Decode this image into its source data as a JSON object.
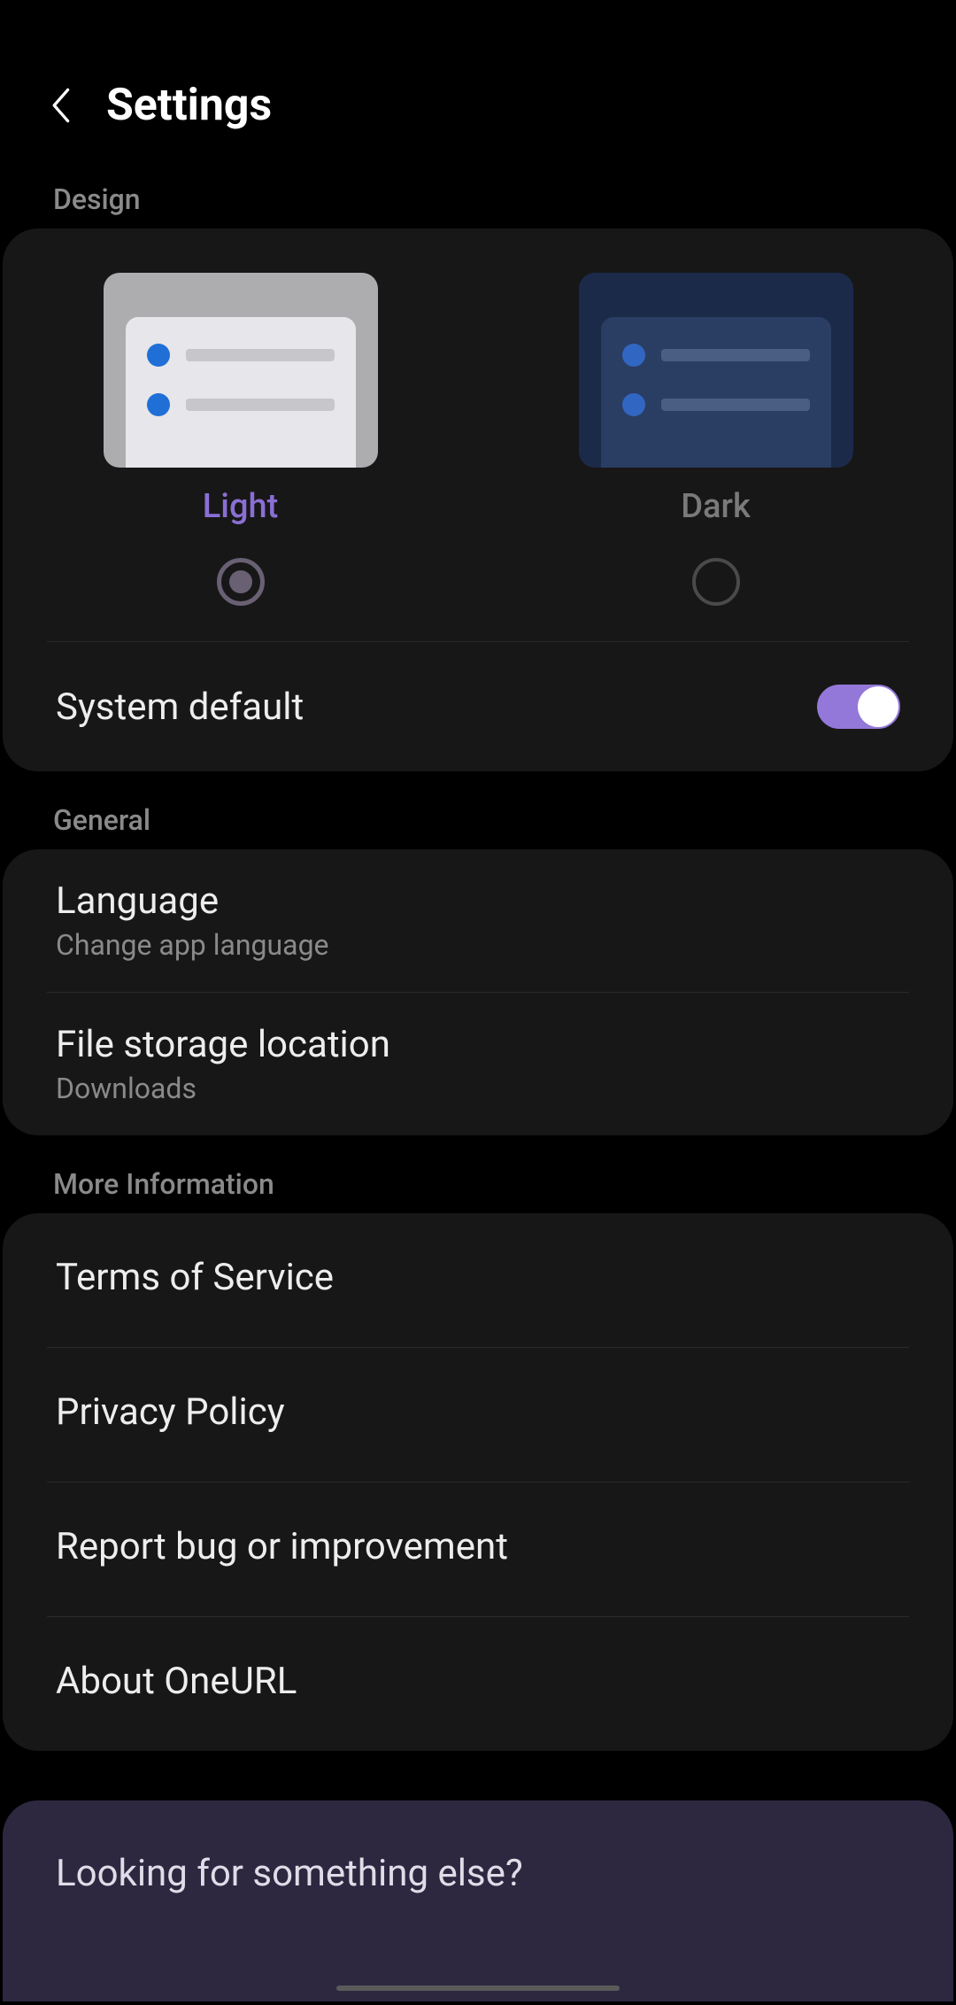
{
  "header": {
    "title": "Settings"
  },
  "design": {
    "section_label": "Design",
    "light_label": "Light",
    "dark_label": "Dark",
    "system_default_label": "System default"
  },
  "general": {
    "section_label": "General",
    "language_title": "Language",
    "language_subtitle": "Change app language",
    "storage_title": "File storage location",
    "storage_subtitle": "Downloads"
  },
  "more_info": {
    "section_label": "More Information",
    "terms": "Terms of Service",
    "privacy": "Privacy Policy",
    "report": "Report bug or improvement",
    "about": "About OneURL"
  },
  "footer": {
    "looking_for": "Looking for something else?"
  }
}
